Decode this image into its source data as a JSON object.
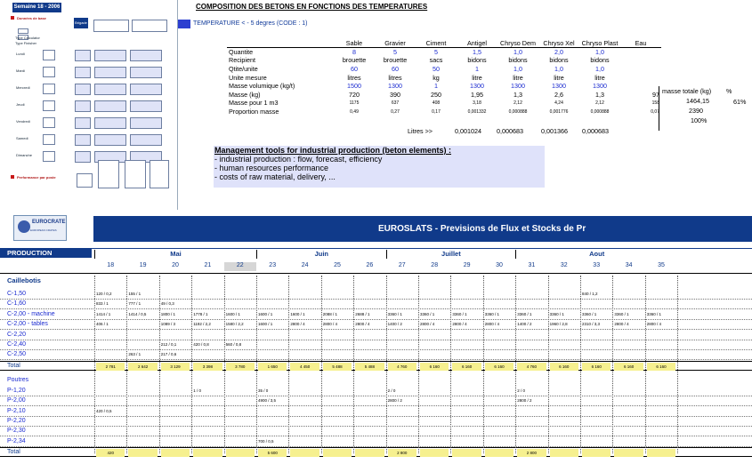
{
  "mini": {
    "header": "Semaine 18 - 2006",
    "brigade": "Brigade",
    "donnees_base": "Données de base",
    "type_calculator": "Type Calculator",
    "type_finisher": "Type Finisher",
    "performance": "Performance par poste",
    "days": [
      "Lundi",
      "Mardi",
      "Mercredi",
      "Jeudi",
      "Vendredi",
      "Samedi",
      "Dimanche"
    ]
  },
  "composition": {
    "title": "COMPOSITION DES BETONS EN FONCTIONS DES TEMPERATURES",
    "temperature": "TEMPERATURE < - 5 degres (CODE : 1)",
    "columns": [
      "Sable",
      "Gravier",
      "Ciment",
      "Antigel",
      "Chryso Dem",
      "Chryso Xel",
      "Chryso Plast",
      "Eau"
    ],
    "rows": [
      {
        "label": "Quantite",
        "values": [
          "8",
          "5",
          "5",
          "1,5",
          "1,0",
          "2,0",
          "1,0",
          ""
        ],
        "blue": true
      },
      {
        "label": "Recipient",
        "values": [
          "brouette",
          "brouette",
          "sacs",
          "bidons",
          "bidons",
          "bidons",
          "bidons",
          ""
        ]
      },
      {
        "label": "Qtite/unite",
        "values": [
          "60",
          "60",
          "50",
          "1",
          "1,0",
          "1,0",
          "1,0",
          ""
        ],
        "blue": true
      },
      {
        "label": "Unite mesure",
        "values": [
          "litres",
          "litres",
          "kg",
          "litre",
          "litre",
          "litre",
          "litre",
          ""
        ]
      },
      {
        "label": "Masse volumique (kg/t)",
        "values": [
          "1500",
          "1300",
          "1",
          "1300",
          "1300",
          "1300",
          "1300",
          ""
        ],
        "blue": true
      },
      {
        "label": "Masse (kg)",
        "values": [
          "720",
          "390",
          "250",
          "1,95",
          "1,3",
          "2,6",
          "1,3",
          "97"
        ]
      },
      {
        "label": "Masse pour 1 m3",
        "values": [
          "1175",
          "637",
          "408",
          "3,18",
          "2,12",
          "4,24",
          "2,12",
          "158"
        ],
        "small": true
      },
      {
        "label": "Proportion masse",
        "values": [
          "0,49",
          "0,27",
          "0,17",
          "0,001332",
          "0,000888",
          "0,001776",
          "0,000888",
          "0,07"
        ],
        "small": true
      }
    ],
    "litres_label": "Litres >>",
    "litres_values": [
      "0,001024",
      "0,000683",
      "0,001366",
      "0,000683"
    ],
    "masse_totale_label": "masse totale (kg)",
    "percent_label": "%",
    "masse_totale_values": [
      "1464,15",
      "2390",
      "100%"
    ],
    "percent_value": "61%"
  },
  "management": {
    "title": "Management tools for industrial production (beton elements) :",
    "items": [
      "- industrial production : flow, forecast, efficiency",
      "- human resources performance",
      "- costs of raw material, delivery, ..."
    ]
  },
  "sheet": {
    "logo": "EUROCRATE",
    "logo_sub": "EUROPEAN CRATES",
    "banner": "EUROSLATS - Previsions de Flux et Stocks de Pr",
    "production": "PRODUCTION",
    "months": [
      "Mai",
      "Juin",
      "Juillet",
      "Aout"
    ],
    "weeks": [
      "18",
      "19",
      "20",
      "21",
      "22",
      "23",
      "24",
      "25",
      "26",
      "27",
      "28",
      "29",
      "30",
      "31",
      "32",
      "33",
      "34",
      "35"
    ],
    "section1": "Caillebotis",
    "rows1": [
      {
        "label": "C-1,50",
        "cells": {
          "0": "120 / 0,2",
          "1": "155 / 1",
          "15": "840 / 1,2"
        }
      },
      {
        "label": "C-1,60",
        "cells": {
          "0": "833 / 1",
          "1": "777 / 1",
          "2": "49 / 0,3"
        }
      },
      {
        "label": "C-2,00 - machine",
        "cells": {
          "0": "1414 / 1",
          "1": "1414 / 0,5",
          "2": "1800 / 1",
          "3": "1778 / 1",
          "4": "1600 / 1",
          "5": "1600 / 1",
          "6": "1600 / 1",
          "7": "2088 / 1",
          "8": "2688 / 1",
          "9": "3360 / 1",
          "10": "3360 / 1",
          "11": "3360 / 1",
          "12": "3360 / 1",
          "13": "3360 / 1",
          "14": "3360 / 1",
          "15": "3360 / 1",
          "16": "3360 / 1",
          "17": "3360 / 1"
        }
      },
      {
        "label": "C-2,00 - tables",
        "cells": {
          "0": "406 / 1",
          "2": "1089 / 3",
          "3": "1192 / 2,2",
          "4": "1580 / 2,2",
          "5": "1600 / 1",
          "6": "2800 / 4",
          "7": "2800 / 4",
          "8": "2800 / 4",
          "9": "1400 / 2",
          "10": "2800 / 4",
          "11": "2800 / 4",
          "12": "2800 / 4",
          "13": "1400 / 2",
          "14": "1960 / 2,8",
          "15": "2310 / 3,3",
          "16": "2800 / 4",
          "17": "2800 / 4"
        }
      },
      {
        "label": "C-2,20",
        "cells": {}
      },
      {
        "label": "C-2,40",
        "cells": {
          "2": "212 / 0,1",
          "3": "420 / 0,8",
          "4": "560 / 0,8"
        }
      },
      {
        "label": "C-2,50",
        "cells": {
          "1": "263 / 1",
          "2": "217 / 0,6"
        }
      }
    ],
    "total1_label": "Total",
    "total1": [
      "2 781",
      "2 642",
      "3 129",
      "3 398",
      "3 780",
      "1 650",
      "4 450",
      "5 488",
      "5 488",
      "4 760",
      "6 160",
      "6 160",
      "6 160",
      "4 760",
      "6 160",
      "6 160",
      "6 160",
      "6 160"
    ],
    "section2": "Poutres",
    "rows2": [
      {
        "label": "P-1,20",
        "cells": {
          "3": "1 / 0",
          "5": "35 / 0",
          "9": "2 / 0",
          "13": "2 / 0"
        }
      },
      {
        "label": "P-2,00",
        "cells": {
          "5": "4900 / 3,5",
          "9": "2800 / 2",
          "13": "2800 / 2"
        }
      },
      {
        "label": "P-2,10",
        "cells": {
          "0": "420 / 0,5"
        }
      },
      {
        "label": "P-2,20",
        "cells": {}
      },
      {
        "label": "P-2,30",
        "cells": {}
      },
      {
        "label": "P-2,34",
        "cells": {
          "5": "700 / 0,5"
        }
      }
    ],
    "total2_label": "Total",
    "total2": {
      "0": "420",
      "5": "5 600",
      "9": "2 800",
      "13": "2 800"
    }
  },
  "colors": {
    "navy": "#103a8a",
    "yellow": "#f6f08f",
    "blue_text": "#1b2bd0",
    "lavender": "#dfe2fa"
  }
}
